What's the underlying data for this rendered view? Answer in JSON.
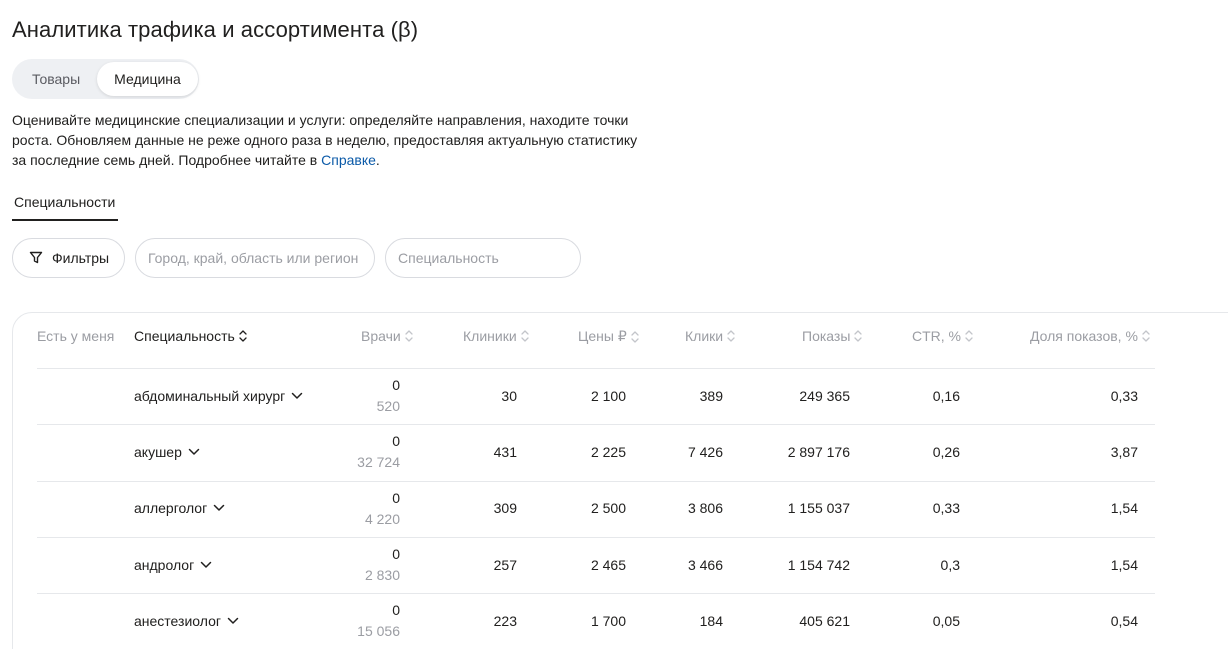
{
  "title": "Аналитика трафика и ассортимента (β)",
  "segments": [
    "Товары",
    "Медицина"
  ],
  "active_segment": "Медицина",
  "description": {
    "text": "Оценивайте медицинские специализации и услуги: определяйте направления, находите точки роста. Обновляем данные не реже одного раза в неделю, предоставляя актуальную статистику за последние семь дней. Подробнее читайте в ",
    "link": "Справке",
    "end": "."
  },
  "subtab": "Специальности",
  "filters": {
    "button_label": "Фильтры",
    "region_placeholder": "Город, край, область или регион",
    "specialty_placeholder": "Специальность"
  },
  "table": {
    "headers": {
      "have": "Есть у меня",
      "specialty": "Специальность",
      "doctors": "Врачи",
      "clinics": "Клиники",
      "prices": "Цены ₽",
      "clicks": "Клики",
      "shows": "Показы",
      "ctr": "CTR, %",
      "share": "Доля показов, %"
    },
    "rows": [
      {
        "specialty": "абдоминальный хирург",
        "doctors_mine": "0",
        "doctors_total": "520",
        "clinics": "30",
        "price": "2 100",
        "clicks": "389",
        "shows": "249 365",
        "ctr": "0,16",
        "share": "0,33"
      },
      {
        "specialty": "акушер",
        "doctors_mine": "0",
        "doctors_total": "32 724",
        "clinics": "431",
        "price": "2 225",
        "clicks": "7 426",
        "shows": "2 897 176",
        "ctr": "0,26",
        "share": "3,87"
      },
      {
        "specialty": "аллерголог",
        "doctors_mine": "0",
        "doctors_total": "4 220",
        "clinics": "309",
        "price": "2 500",
        "clicks": "3 806",
        "shows": "1 155 037",
        "ctr": "0,33",
        "share": "1,54"
      },
      {
        "specialty": "андролог",
        "doctors_mine": "0",
        "doctors_total": "2 830",
        "clinics": "257",
        "price": "2 465",
        "clicks": "3 466",
        "shows": "1 154 742",
        "ctr": "0,3",
        "share": "1,54"
      },
      {
        "specialty": "анестезиолог",
        "doctors_mine": "0",
        "doctors_total": "15 056",
        "clinics": "223",
        "price": "1 700",
        "clicks": "184",
        "shows": "405 621",
        "ctr": "0,05",
        "share": "0,54"
      }
    ]
  },
  "icons": {
    "filter": "funnel-icon",
    "sort": "sort-arrows-icon",
    "expand": "chevron-down-icon"
  },
  "colors": {
    "text": "#21201f",
    "muted": "#9b9da3",
    "link": "#0b5aa8",
    "segment_bg": "#eef0f3",
    "border": "#d9dbe0"
  }
}
